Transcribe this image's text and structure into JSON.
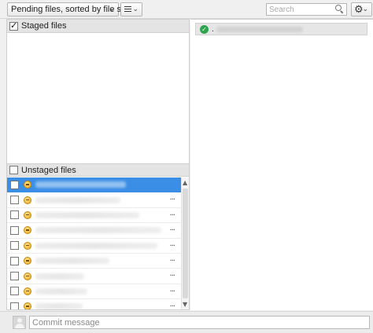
{
  "toolbar": {
    "view_mode_label": "Pending files, sorted by file status",
    "search_placeholder": "Search"
  },
  "staged": {
    "header_label": "Staged files",
    "checked": true
  },
  "unstaged": {
    "header_label": "Unstaged files",
    "checked": false
  },
  "right_panel": {
    "status_text": "."
  },
  "commit": {
    "message_placeholder": "Commit message"
  },
  "icons": {
    "more": "more-icon",
    "status": "modified-status-icon",
    "check": "check-circle-icon",
    "gear": "gear-icon",
    "search": "search-icon",
    "avatar": "avatar"
  },
  "colors": {
    "selection": "#3a8ee6",
    "status_ok": "#2ea44f",
    "modified": "#e8a71b"
  }
}
